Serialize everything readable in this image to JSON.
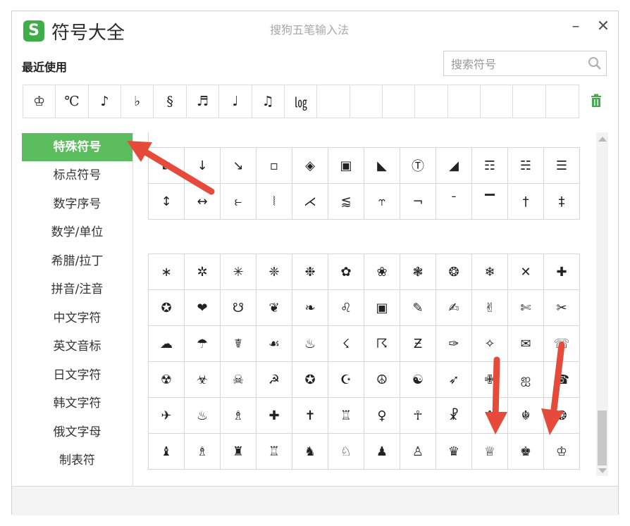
{
  "window": {
    "title": "符号大全",
    "subtitle": "搜狗五笔输入法",
    "logo_letter": "S",
    "minimize": "–",
    "close": "✕"
  },
  "colors": {
    "accent_green": "#5bbd5e",
    "logo_green": "#3fae49",
    "annotation_red": "#e64a3b"
  },
  "recent": {
    "label": "最近使用",
    "symbols": [
      "♔",
      "℃",
      "♪",
      "♭",
      "§",
      "♬",
      "♩",
      "♫",
      "㏒",
      "",
      "",
      "",
      "",
      "",
      "",
      "",
      ""
    ],
    "clear_icon": "trash-icon"
  },
  "search": {
    "placeholder": "搜索符号",
    "value": ""
  },
  "sidebar": {
    "items": [
      {
        "label": "特殊符号",
        "active": true
      },
      {
        "label": "标点符号"
      },
      {
        "label": "数字序号"
      },
      {
        "label": "数学/单位"
      },
      {
        "label": "希腊/拉丁"
      },
      {
        "label": "拼音/注音"
      },
      {
        "label": "中文字符"
      },
      {
        "label": "英文音标"
      },
      {
        "label": "日文字符"
      },
      {
        "label": "韩文字符"
      },
      {
        "label": "俄文字母"
      },
      {
        "label": "制表符"
      }
    ]
  },
  "grid_a": [
    [
      "↙",
      "↓",
      "↘",
      "▫",
      "◈",
      "▣",
      "◣",
      "Ⓣ",
      "◢",
      "☶",
      "☵",
      "☰"
    ],
    [
      "↕",
      "↔",
      "⥼",
      "⦚",
      "⋌",
      "⪅",
      "⥾",
      "¬",
      "¯",
      "▔",
      "†",
      "‡"
    ]
  ],
  "grid_b": [
    [
      "∗",
      "✲",
      "✳",
      "❈",
      "❉",
      "✿",
      "❀",
      "❃",
      "❂",
      "❄",
      "✕",
      "✚"
    ],
    [
      "✪",
      "❤",
      "☋",
      "❦",
      "❧",
      "♌",
      "▣",
      "✎",
      "✍",
      "✌",
      "✄",
      "✂"
    ],
    [
      "☁",
      "☂",
      "☤",
      "☙",
      "♨",
      "☇",
      "☈",
      "Ƶ",
      "✑",
      "✧",
      "✉",
      "☏"
    ],
    [
      "☢",
      "☣",
      "☠",
      "☭",
      "✪",
      "☪",
      "☮",
      "☯",
      "➶",
      "✙",
      "ஐ",
      "☎"
    ],
    [
      "✈",
      "♨",
      "♗",
      "✚",
      "✝",
      "♖",
      "♀",
      "☥",
      "☧",
      "♆",
      "☬",
      "❂"
    ],
    [
      "♝",
      "♗",
      "♜",
      "♖",
      "♞",
      "♘",
      "♟",
      "♙",
      "♛",
      "♕",
      "♚",
      "♔"
    ]
  ]
}
